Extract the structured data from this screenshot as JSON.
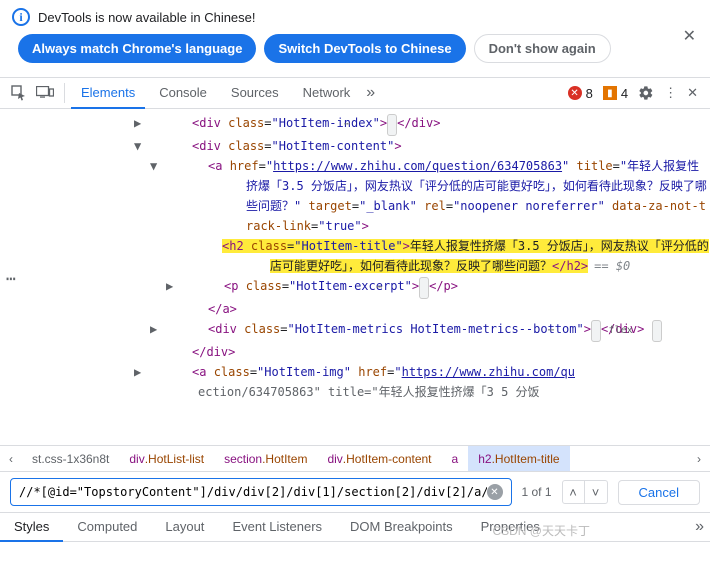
{
  "banner": {
    "text": "DevTools is now available in Chinese!",
    "btn_match": "Always match Chrome's language",
    "btn_switch": "Switch DevTools to Chinese",
    "btn_dont": "Don't show again"
  },
  "tabs": {
    "elements": "Elements",
    "console": "Console",
    "sources": "Sources",
    "network": "Network"
  },
  "badges": {
    "errors": "8",
    "warnings": "4"
  },
  "tree": {
    "div_index": {
      "open": "<div class=\"HotItem-index\">",
      "close": "</div>"
    },
    "div_content": {
      "open": "<div class=\"HotItem-content\">"
    },
    "a_href": "https://www.zhihu.com/question/634705863",
    "a_title": "年轻人报复性挤爆「3.5 分饭店」，网友热议「评分低的店可能更好吃」，如何看待此现象？反映了哪些问题？",
    "a_target": "_blank",
    "a_rel": "noopener noreferrer",
    "a_track": "true",
    "h2_class": "HotItem-title",
    "h2_text": "年轻人报复性挤爆「3.5 分饭店」，网友热议「评分低的店可能更好吃」，如何看待此现象？反映了哪些问题？",
    "eq0": "== $0",
    "p_excerpt": {
      "open": "<p class=\"HotItem-excerpt\">",
      "close": "</p>"
    },
    "a_close": "</a>",
    "div_metrics": {
      "open": "<div class=\"HotItem-metrics HotItem-metrics--bottom\">",
      "close": "</div>",
      "flex": "flex"
    },
    "div_close": "</div>",
    "a_img_href": "https://www.zhihu.com/qu",
    "a_img_class": "HotItem-img",
    "trunc_line": "ection/634705863\" title=\"年轻人报复性挤爆「3 5 分饭"
  },
  "breadcrumb": {
    "trunc": "st.css-1x36n8t",
    "c1_pfx": "div",
    "c1_cls": ".HotList-list",
    "c2_pfx": "section",
    "c2_cls": ".HotItem",
    "c3_pfx": "div",
    "c3_cls": ".HotItem-content",
    "c4": "a",
    "c5_pfx": "h2",
    "c5_cls": ".HotItem-title"
  },
  "search": {
    "value": "//*[@id=\"TopstoryContent\"]/div/div[2]/div[1]/section[2]/div[2]/a/h",
    "count": "1 of 1",
    "cancel": "Cancel"
  },
  "styles_tabs": {
    "styles": "Styles",
    "computed": "Computed",
    "layout": "Layout",
    "events": "Event Listeners",
    "dom": "DOM Breakpoints",
    "props": "Properties"
  },
  "watermark": "CSDN @天天卡丁"
}
